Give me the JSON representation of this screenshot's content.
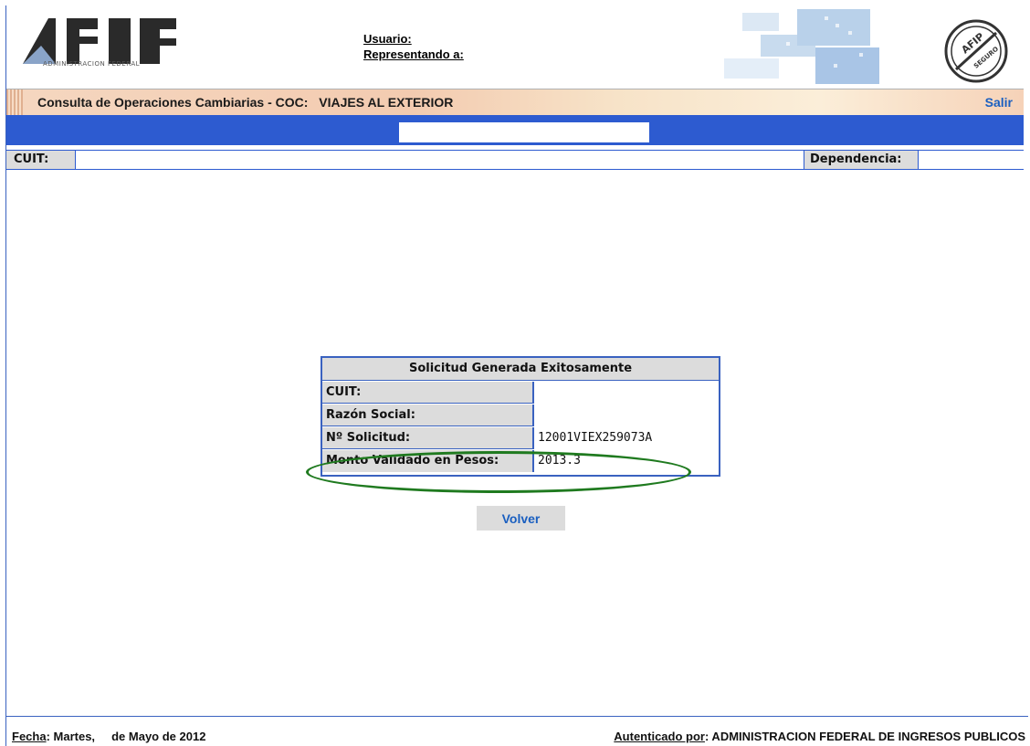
{
  "header": {
    "logo_text": "AFIP",
    "logo_subtitle": "ADMINISTRACION FEDERAL",
    "user_label": "Usuario:",
    "representing_label": "Representando a:",
    "seal_text": "AFIP SITIO SEGURO"
  },
  "title_bar": {
    "title": "Consulta de Operaciones Cambiarias - COC:",
    "subtitle": "VIAJES AL EXTERIOR",
    "exit_label": "Salir"
  },
  "info_bar": {
    "cuit_label": "CUIT:",
    "dependencia_label": "Dependencia:"
  },
  "result": {
    "title": "Solicitud Generada Exitosamente",
    "rows": [
      {
        "label": "CUIT:",
        "value": ""
      },
      {
        "label": "Razón Social:",
        "value": ""
      },
      {
        "label": "Nº Solicitud:",
        "value": "12001VIEX259073A"
      },
      {
        "label": "Monto Validado en Pesos:",
        "value": "2013.3"
      }
    ]
  },
  "actions": {
    "back_label": "Volver"
  },
  "footer": {
    "fecha_label": "Fecha",
    "fecha_value": ": Martes,     de Mayo de 2012",
    "auth_label": "Autenticado por",
    "auth_value": ": ADMINISTRACION FEDERAL DE INGRESOS PUBLICOS"
  },
  "colors": {
    "accent_blue": "#2d5bd0",
    "link_blue": "#1a5fc0",
    "highlight_green": "#1f7a1f",
    "label_gray": "#dcdcdc"
  }
}
